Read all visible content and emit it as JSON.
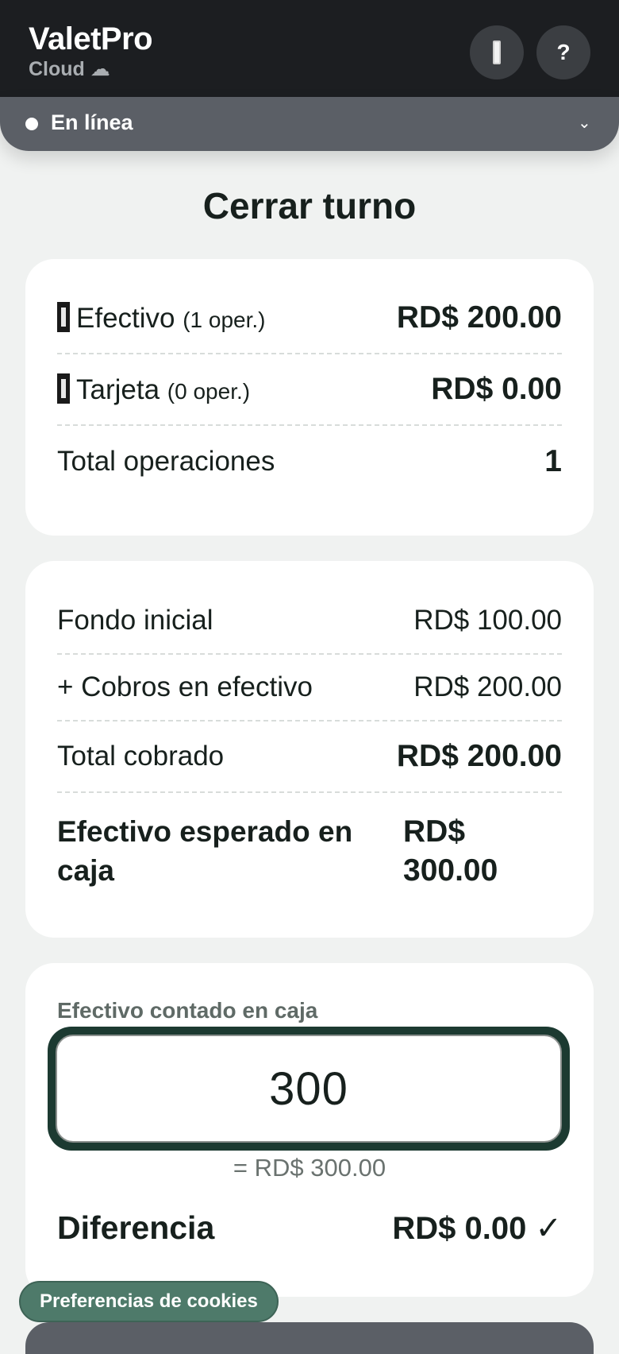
{
  "header": {
    "app_title": "ValetPro",
    "app_subtitle": "Cloud ☁",
    "help_label": "?"
  },
  "status": {
    "label": "En línea",
    "chevron": "⌄"
  },
  "page": {
    "title": "Cerrar turno"
  },
  "summary": {
    "rows": [
      {
        "icon": "cash-icon",
        "label": "Efectivo",
        "count": "(1 oper.)",
        "value": "RD$ 200.00"
      },
      {
        "icon": "card-icon",
        "label": "Tarjeta",
        "count": "(0 oper.)",
        "value": "RD$ 0.00"
      }
    ],
    "total_label": "Total operaciones",
    "total_value": "1"
  },
  "cash": {
    "fondo_label": "Fondo inicial",
    "fondo_value": "RD$ 100.00",
    "cobros_label": "+ Cobros en efectivo",
    "cobros_value": "RD$ 200.00",
    "total_label": "Total cobrado",
    "total_value": "RD$ 200.00",
    "expected_label": "Efectivo esperado en caja",
    "expected_value": "RD$ 300.00"
  },
  "count": {
    "field_label": "Efectivo contado en caja",
    "input_value": "300",
    "equiv": "= RD$ 300.00",
    "diff_label": "Diferencia",
    "diff_value": "RD$ 0.00 ✓"
  },
  "cookies": {
    "label": "Preferencias de cookies"
  },
  "colors": {
    "header_bg": "#1c1e21",
    "status_bg": "#5b5f66",
    "accent_green": "#1c3a31",
    "cookie_bg": "#4e7a6a"
  }
}
